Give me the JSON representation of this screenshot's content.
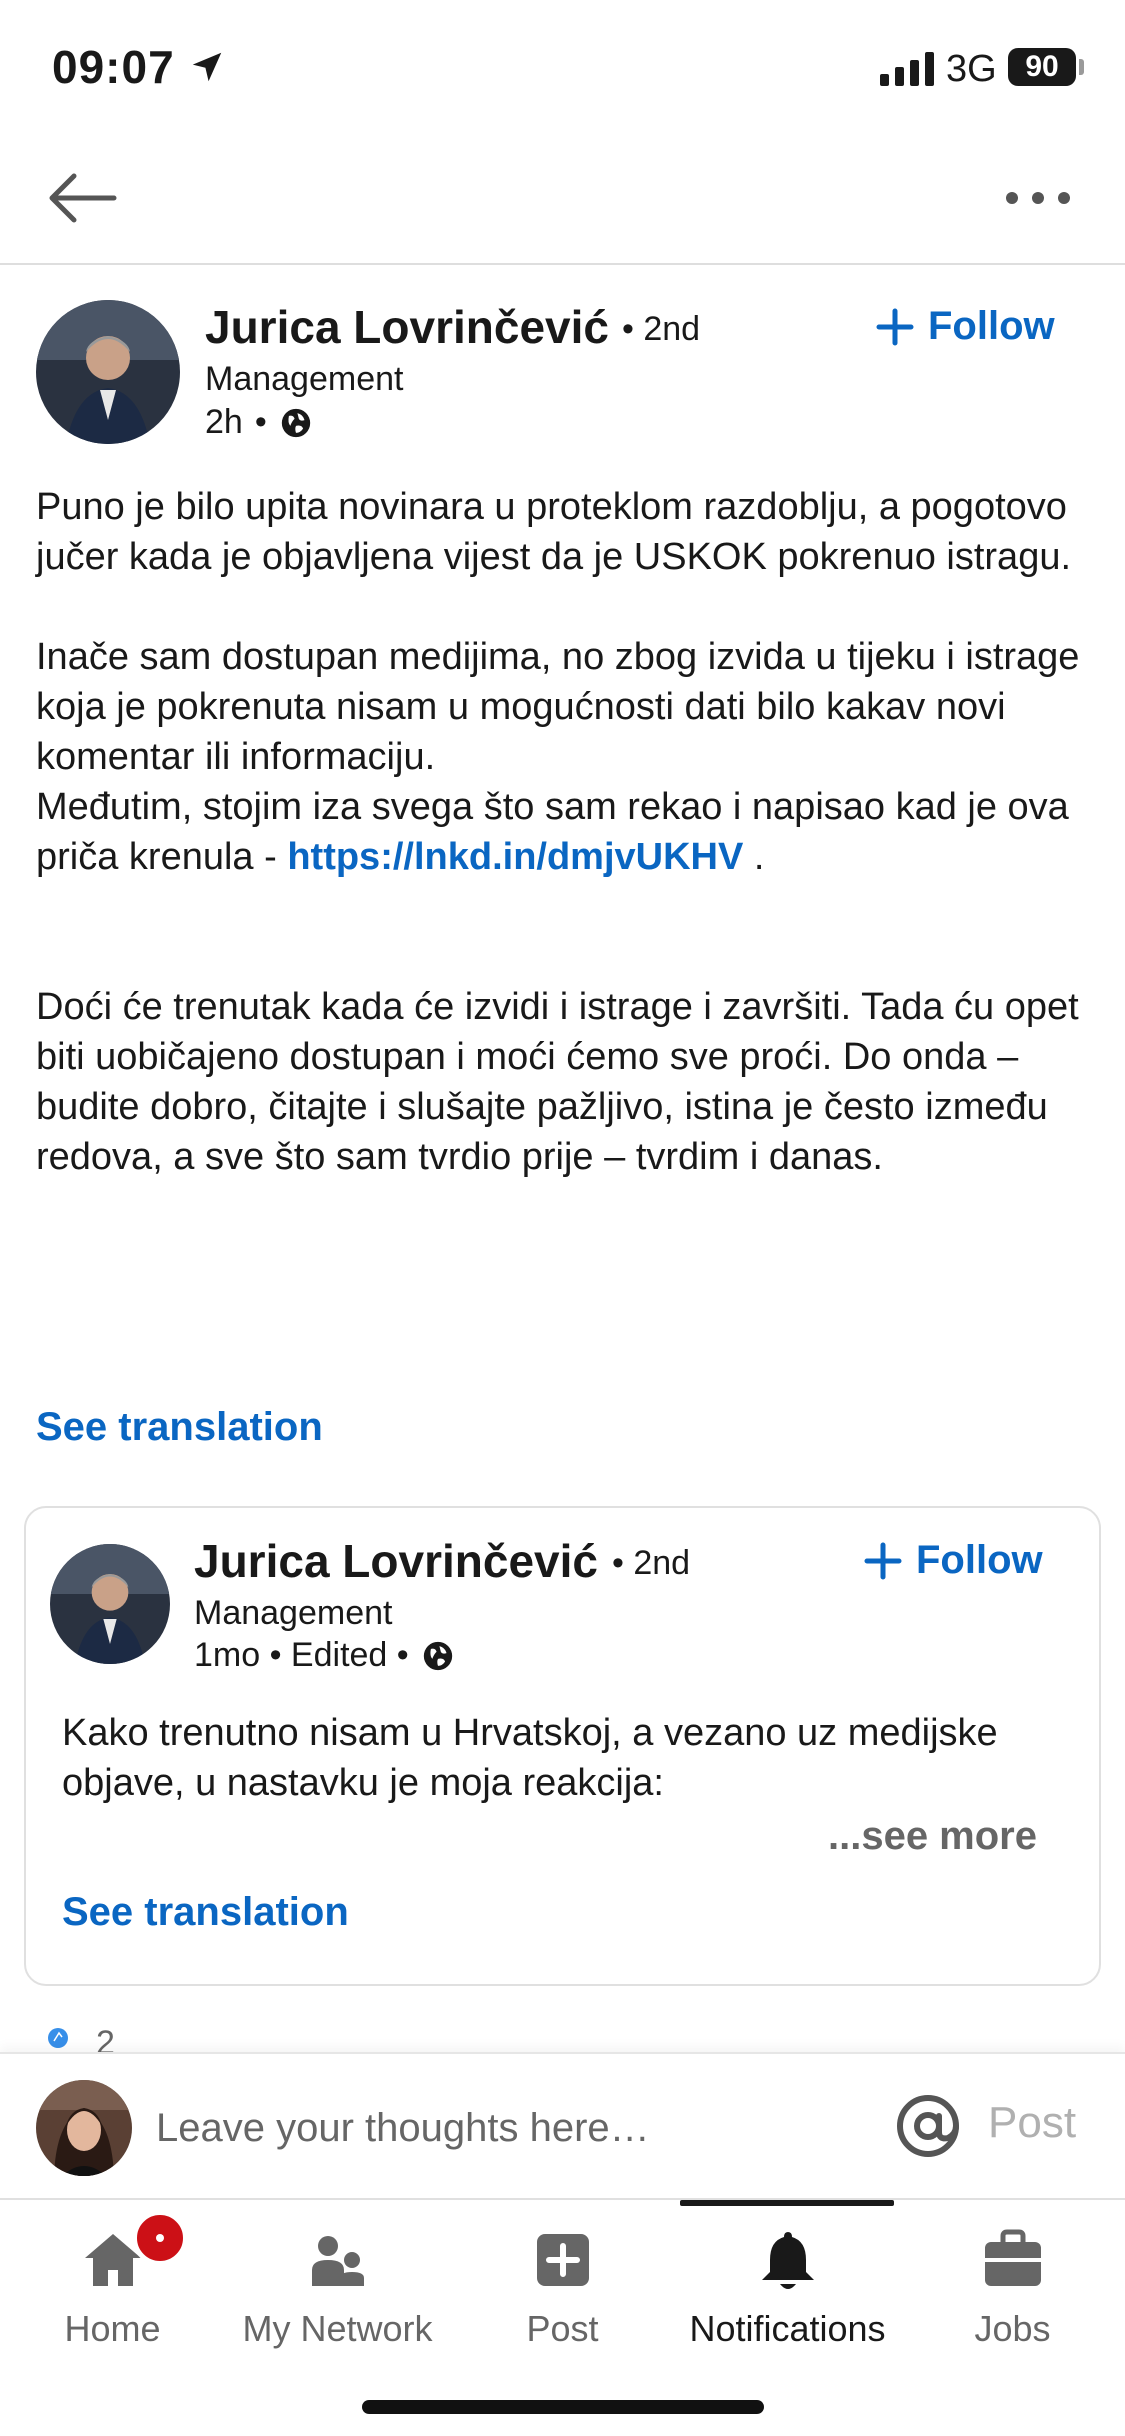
{
  "status_bar": {
    "time": "09:07",
    "network": "3G",
    "battery": "90"
  },
  "post": {
    "author": "Jurica Lovrinčević",
    "degree": "• 2nd",
    "headline": "Management",
    "time": "2h",
    "follow_label": "Follow",
    "body_p1": "Puno je bilo upita novinara u proteklom razdoblju, a pogotovo jučer kada je objavljena vijest da je USKOK pokrenuo istragu.",
    "body_p2": "Inače sam dostupan medijima, no zbog izvida u tijeku i istrage koja je pokrenuta nisam u mogućnosti dati bilo kakav novi komentar ili informaciju.",
    "body_p3_prefix": "Međutim, stojim iza svega što sam rekao i napisao kad je ova priča krenula - ",
    "link": "https://lnkd.in/dmjvUKHV",
    "body_p3_suffix": " .",
    "body_p4": "Doći će trenutak kada će izvidi i istrage i završiti. Tada ću opet biti uobičajeno dostupan i moći ćemo sve proći. Do onda – budite dobro, čitajte i slušajte pažljivo, istina je često između redova, a sve što sam tvrdio prije – tvrdim i danas.",
    "see_translation": "See translation"
  },
  "shared_post": {
    "author": "Jurica Lovrinčević",
    "degree": "• 2nd",
    "headline": "Management",
    "time": "1mo • Edited •",
    "follow_label": "Follow",
    "body": "Kako trenutno nisam u Hrvatskoj, a vezano uz medijske objave, u nastavku je moja reakcija:",
    "see_more": "...see more",
    "see_translation": "See translation"
  },
  "reactions": {
    "count": "2"
  },
  "comment_bar": {
    "placeholder": "Leave your thoughts here…",
    "post_label": "Post"
  },
  "bottom_nav": {
    "items": [
      {
        "label": "Home",
        "icon": "home-icon"
      },
      {
        "label": "My Network",
        "icon": "network-icon"
      },
      {
        "label": "Post",
        "icon": "post-icon"
      },
      {
        "label": "Notifications",
        "icon": "bell-icon"
      },
      {
        "label": "Jobs",
        "icon": "jobs-icon"
      }
    ],
    "active": "Notifications"
  },
  "colors": {
    "accent": "#0a66c2",
    "text": "#191919",
    "muted": "#666666",
    "badge": "#cc1016"
  }
}
